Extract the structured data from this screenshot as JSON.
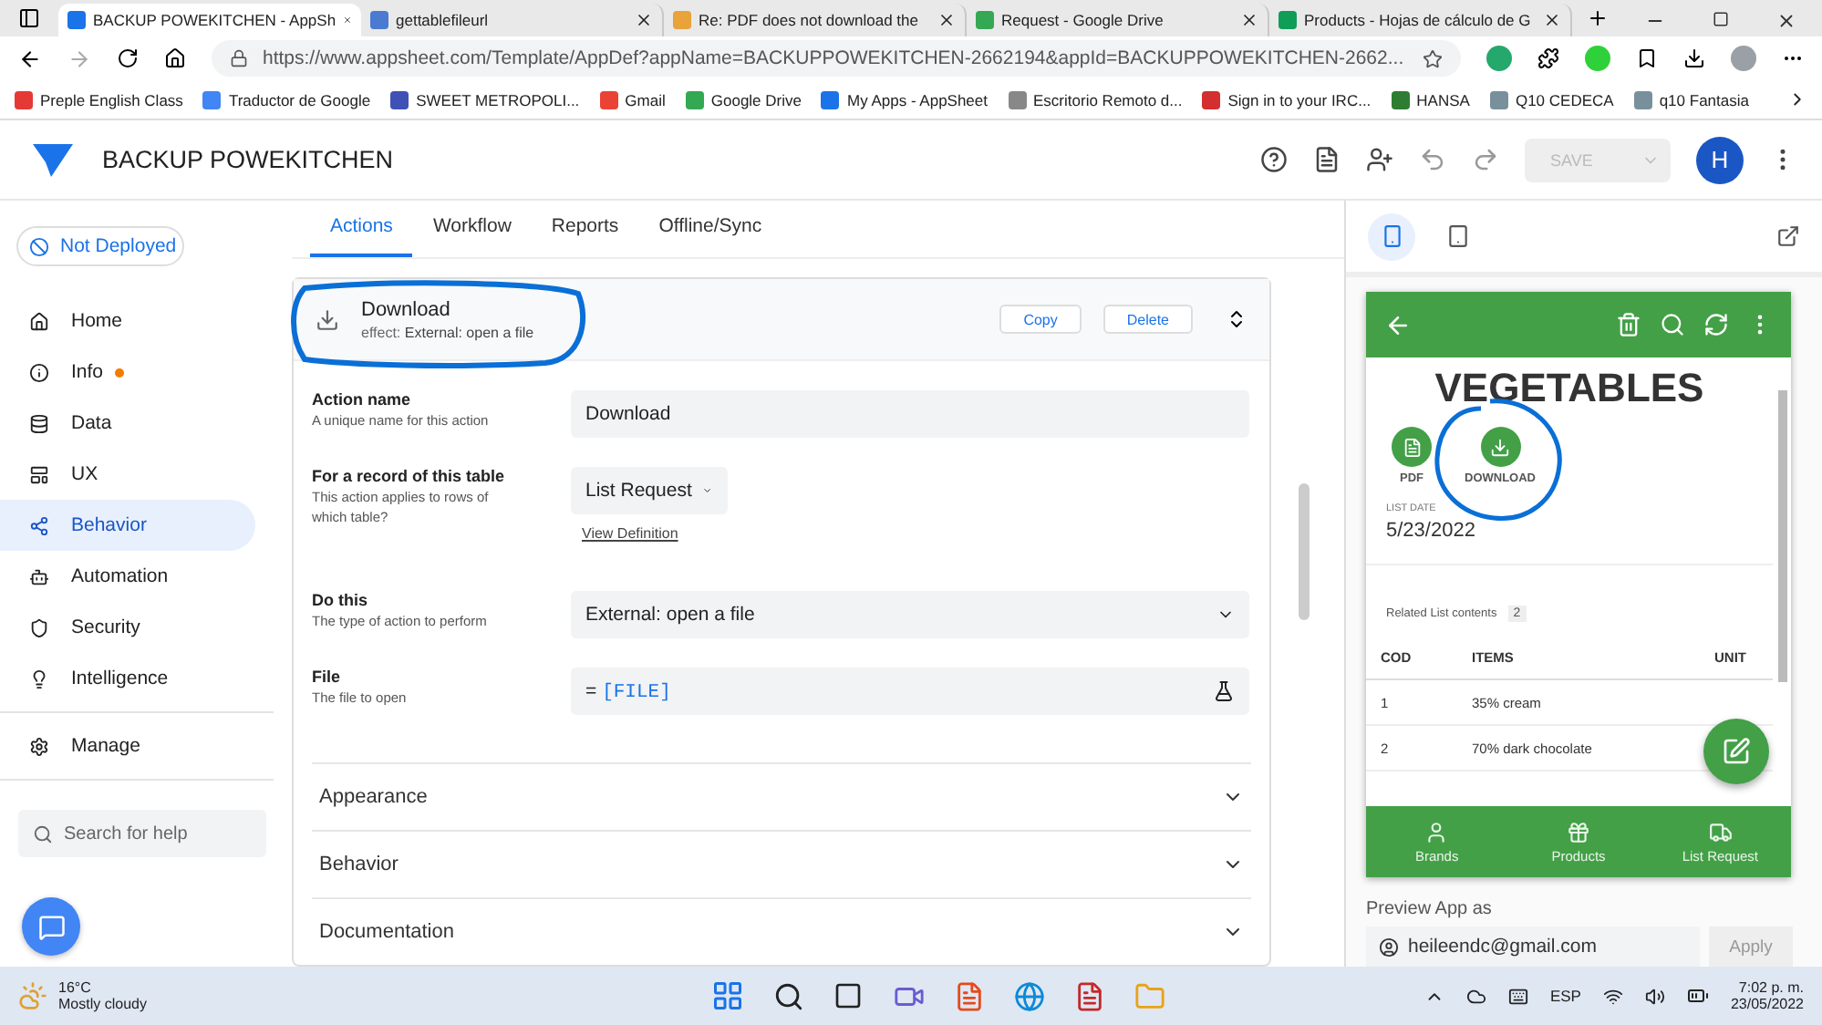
{
  "browser": {
    "tabs": [
      {
        "title": "BACKUP POWEKITCHEN - AppSh",
        "selected": true,
        "kind": "appsheet"
      },
      {
        "title": "gettablefileurl",
        "selected": false,
        "kind": "letter"
      },
      {
        "title": "Re: PDF does not download the",
        "selected": false,
        "kind": "community"
      },
      {
        "title": "Request - Google Drive",
        "selected": false,
        "kind": "drive"
      },
      {
        "title": "Products - Hojas de cálculo de G",
        "selected": false,
        "kind": "sheets"
      }
    ],
    "url": "https://www.appsheet.com/Template/AppDef?appName=BACKUPPOWEKITCHEN-2662194&appId=BACKUPPOWEKITCHEN-2662...",
    "bookmarks": [
      "Preple English Class",
      "Traductor de Google",
      "SWEET METROPOLI...",
      "Gmail",
      "Google Drive",
      "My Apps - AppSheet",
      "Escritorio Remoto d...",
      "Sign in to your IRC...",
      "HANSA",
      "Q10 CEDECA",
      "q10 Fantasia"
    ]
  },
  "app": {
    "title": "BACKUP POWEKITCHEN",
    "save": "SAVE",
    "save_disabled": true,
    "avatar": "H"
  },
  "sidebar": {
    "deploy_status": "Not Deployed",
    "items": [
      {
        "label": "Home",
        "selected": false,
        "badge": false
      },
      {
        "label": "Info",
        "selected": false,
        "badge": true
      },
      {
        "label": "Data",
        "selected": false,
        "badge": false
      },
      {
        "label": "UX",
        "selected": false,
        "badge": false
      },
      {
        "label": "Behavior",
        "selected": true,
        "badge": false
      },
      {
        "label": "Automation",
        "selected": false,
        "badge": false
      },
      {
        "label": "Security",
        "selected": false,
        "badge": false
      },
      {
        "label": "Intelligence",
        "selected": false,
        "badge": false
      }
    ],
    "manage": "Manage",
    "search": {
      "placeholder": "Search for help"
    }
  },
  "tabs": [
    {
      "label": "Actions",
      "selected": true
    },
    {
      "label": "Workflow",
      "selected": false
    },
    {
      "label": "Reports",
      "selected": false
    },
    {
      "label": "Offline/Sync",
      "selected": false
    }
  ],
  "action": {
    "name": "Download",
    "effect_label": "effect:",
    "effect": "External: open a file",
    "buttons": [
      "Copy",
      "Delete"
    ]
  },
  "fields": [
    {
      "kind": "text",
      "label": "Action name",
      "hint": "A unique name for this action",
      "value": "Download"
    },
    {
      "kind": "select",
      "label": "For a record of this table",
      "hint": "This action applies to rows of which table?",
      "value": "List Request",
      "link": "View Definition"
    },
    {
      "kind": "dropdown",
      "label": "Do this",
      "hint": "The type of action to perform",
      "value": "External: open a file"
    },
    {
      "kind": "formula",
      "label": "File",
      "hint": "The file to open",
      "prefix": "=",
      "value": "[FILE]"
    }
  ],
  "sections": [
    "Appearance",
    "Behavior",
    "Documentation"
  ],
  "preview": {
    "modes": [
      {
        "kind": "phone",
        "selected": true
      },
      {
        "kind": "tablet",
        "selected": false
      }
    ],
    "title": "VEGETABLES",
    "actions": [
      {
        "kind": "pdf",
        "label": "PDF"
      },
      {
        "kind": "download",
        "label": "DOWNLOAD"
      }
    ],
    "date_label": "LIST DATE",
    "date": "5/23/2022",
    "related_label": "Related List contents",
    "related_count": "2",
    "columns": [
      "COD",
      "ITEMS",
      "UNIT"
    ],
    "rows": [
      [
        "1",
        "35% cream"
      ],
      [
        "2",
        "70% dark chocolate"
      ]
    ],
    "nav": [
      {
        "kind": "brands",
        "label": "Brands"
      },
      {
        "kind": "products",
        "label": "Products"
      },
      {
        "kind": "truck",
        "label": "List Request"
      }
    ],
    "preview_as": "Preview App as",
    "email": "heileendc@gmail.com",
    "apply": "Apply"
  },
  "taskbar": {
    "temp": "16°C",
    "weather": "Mostly cloudy",
    "lang": "ESP",
    "time": "7:02 p. m.",
    "date": "23/05/2022"
  }
}
